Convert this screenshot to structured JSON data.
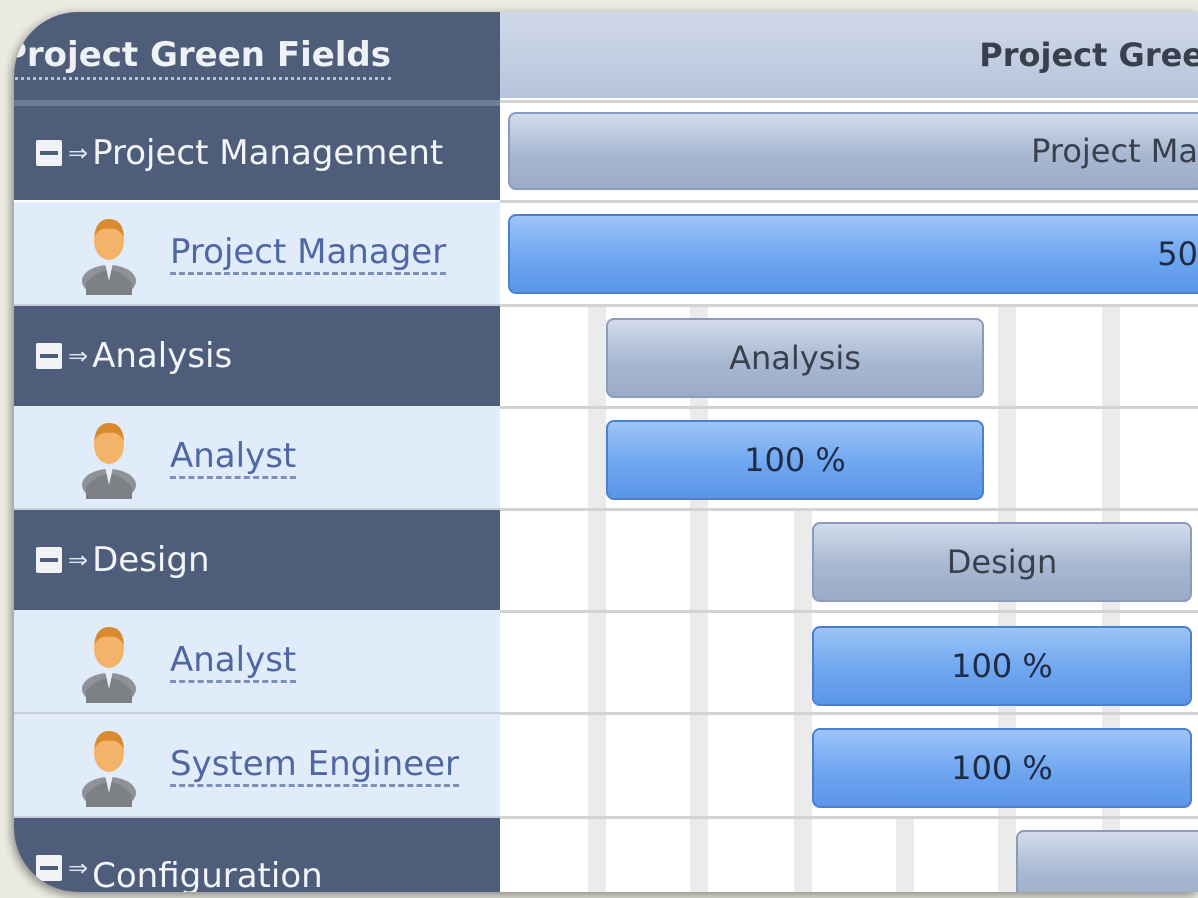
{
  "project": {
    "title": "Project Green Fields",
    "bar_label": "Project Gree"
  },
  "rows": [
    {
      "kind": "summary",
      "label": "Project Management",
      "bar_label": "Project Ma"
    },
    {
      "kind": "resource",
      "label": "Project Manager",
      "bar_label": "50"
    },
    {
      "kind": "summary",
      "label": "Analysis",
      "bar_label": "Analysis"
    },
    {
      "kind": "resource",
      "label": "Analyst",
      "bar_label": "100 %"
    },
    {
      "kind": "summary",
      "label": "Design",
      "bar_label": "Design"
    },
    {
      "kind": "resource",
      "label": "Analyst",
      "bar_label": "100 %"
    },
    {
      "kind": "resource",
      "label": "System Engineer",
      "bar_label": "100 %"
    },
    {
      "kind": "summary",
      "label": "Configuration",
      "bar_label": ""
    }
  ],
  "icons": {
    "collapse": "minus-box-icon",
    "arrow": "arrow-right-icon",
    "person": "person-icon"
  },
  "colors": {
    "summary_bg": "#4d5d7a",
    "resource_bg": "#e1ecfa",
    "bar_blue": "#6ea6f0",
    "bar_gray": "#a8b8d2"
  }
}
